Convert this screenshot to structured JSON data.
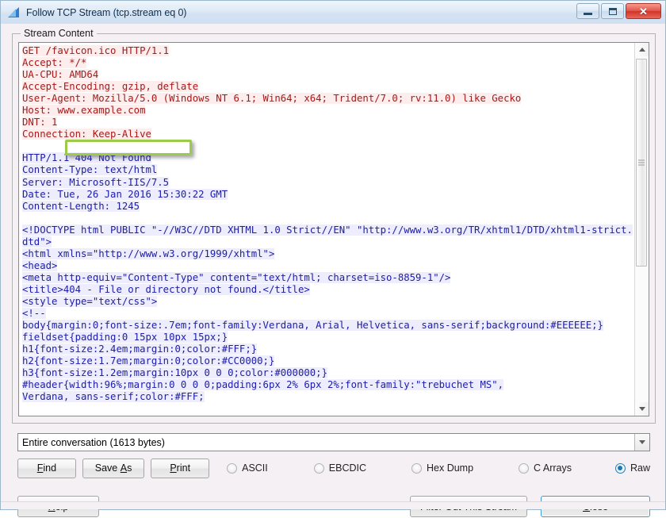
{
  "window": {
    "title": "Follow TCP Stream (tcp.stream eq 0)",
    "icon": "wireshark-shark-fin-icon",
    "buttons": {
      "minimize": "minimize-icon",
      "maximize": "maximize-icon",
      "close": "✕"
    }
  },
  "groupbox": {
    "legend": "Stream Content"
  },
  "stream": {
    "request": "GET /favicon.ico HTTP/1.1\nAccept: */*\nUA-CPU: AMD64\nAccept-Encoding: gzip, deflate\nUser-Agent: Mozilla/5.0 (Windows NT 6.1; Win64; x64; Trident/7.0; rv:11.0) like Gecko\nHost: www.example.com\nDNT: 1\nConnection: Keep-Alive\n\n",
    "response": "HTTP/1.1 404 Not Found\nContent-Type: text/html\nServer: Microsoft-IIS/7.5\nDate: Tue, 26 Jan 2016 15:30:22 GMT\nContent-Length: 1245\n\n<!DOCTYPE html PUBLIC \"-//W3C//DTD XHTML 1.0 Strict//EN\" \"http://www.w3.org/TR/xhtml1/DTD/xhtml1-strict.dtd\">\n<html xmlns=\"http://www.w3.org/1999/xhtml\">\n<head>\n<meta http-equiv=\"Content-Type\" content=\"text/html; charset=iso-8859-1\"/>\n<title>404 - File or directory not found.</title>\n<style type=\"text/css\">\n<!--\nbody{margin:0;font-size:.7em;font-family:Verdana, Arial, Helvetica, sans-serif;background:#EEEEEE;}\nfieldset{padding:0 15px 10px 15px;}\nh1{font-size:2.4em;margin:0;color:#FFF;}\nh2{font-size:1.7em;margin:0;color:#CC0000;}\nh3{font-size:1.2em;margin:10px 0 0 0;color:#000000;}\n#header{width:96%;margin:0 0 0 0;padding:6px 2% 6px 2%;font-family:\"trebuchet MS\",\nVerdana, sans-serif;color:#FFF;",
    "colors": {
      "request_text": "#a81919",
      "request_bg": "#fdeded",
      "response_text": "#1d1da8",
      "response_bg": "#ededfd"
    },
    "annotation": {
      "target": "www.example.com",
      "highlight_color": "#9ccb4a"
    }
  },
  "combo": {
    "value": "Entire conversation (1613 bytes)",
    "arrow": "chevron-down-icon"
  },
  "actions": {
    "find": {
      "pre": "F",
      "mnemonic": "",
      "label": "Find"
    },
    "save_as": {
      "label": "Save As"
    },
    "print": {
      "label": "Print"
    },
    "help": {
      "label": "Help"
    },
    "filter_out": {
      "label": "Filter Out This Stream"
    },
    "close": {
      "label": "Close"
    }
  },
  "format_radios": [
    {
      "label": "ASCII",
      "checked": false
    },
    {
      "label": "EBCDIC",
      "checked": false
    },
    {
      "label": "Hex Dump",
      "checked": false
    },
    {
      "label": "C Arrays",
      "checked": false
    },
    {
      "label": "Raw",
      "checked": true
    }
  ]
}
